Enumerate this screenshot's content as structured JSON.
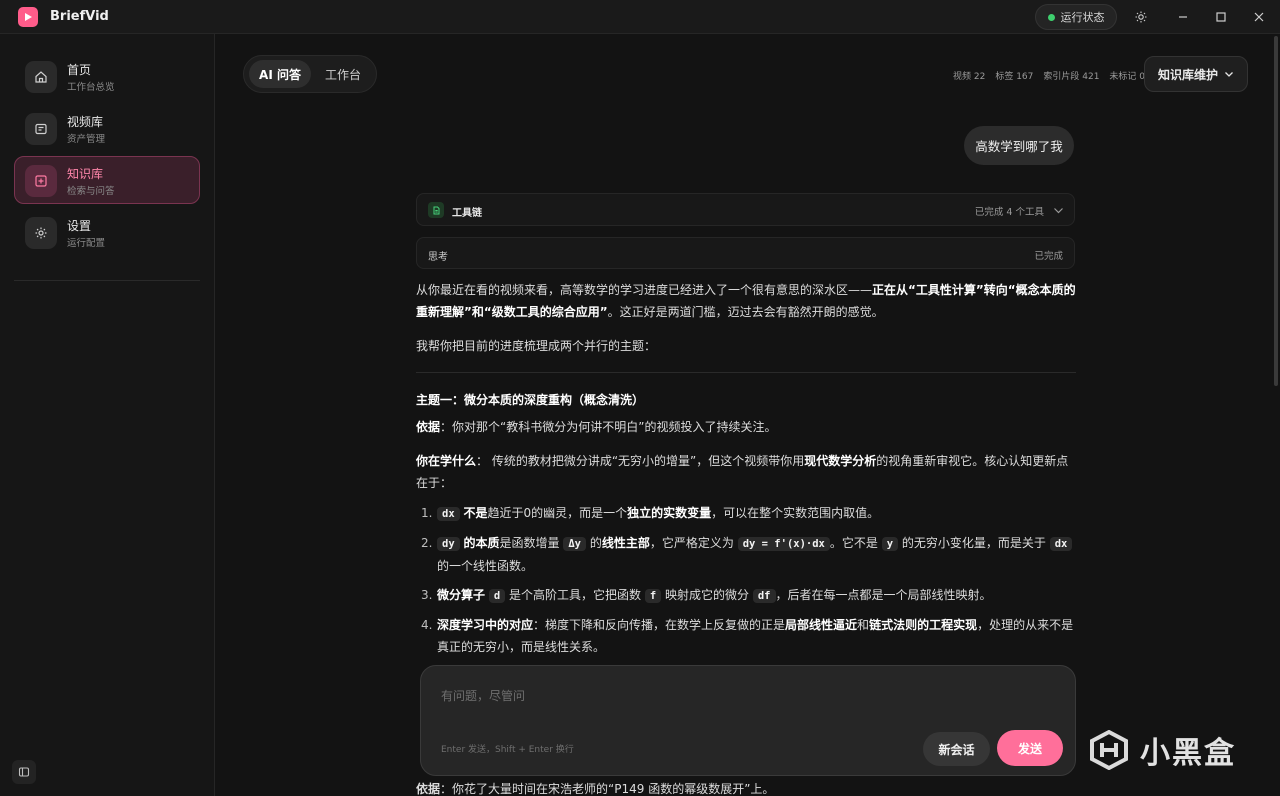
{
  "app": {
    "title": "BriefVid",
    "status_label": "运行状态",
    "status_color": "#3ecf6e",
    "accent": "#ff6f9a"
  },
  "titlebar": {
    "icons": [
      "sun-icon",
      "minimize-icon",
      "maximize-icon",
      "close-icon"
    ]
  },
  "sidebar": {
    "items": [
      {
        "title": "首页",
        "subtitle": "工作台总览",
        "icon": "home-icon"
      },
      {
        "title": "视频库",
        "subtitle": "资产管理",
        "icon": "library-icon"
      },
      {
        "title": "知识库",
        "subtitle": "检索与问答",
        "icon": "knowledge-icon",
        "active": true
      },
      {
        "title": "设置",
        "subtitle": "运行配置",
        "icon": "gear-icon"
      }
    ]
  },
  "tabs": [
    {
      "label": "AI 问答",
      "active": true
    },
    {
      "label": "工作台"
    }
  ],
  "stats": {
    "videos": "视频 22",
    "tags": "标签 167",
    "segments": "索引片段 421",
    "unmarked": "未标记 0"
  },
  "kb_button": {
    "label": "知识库维护"
  },
  "chat": {
    "user_message": "高数学到哪了我",
    "toolchain": {
      "title": "工具链",
      "status": "已完成 4 个工具"
    },
    "thinking": {
      "title": "思考",
      "status": "已完成"
    },
    "intro_1": "从你最近在看的视频来看，高等数学的学习进度已经进入了一个很有意思的深水区——",
    "intro_bold": "正在从“工具性计算”转向“概念本质的重新理解”和“级数工具的综合应用”",
    "intro_2": "。这正好是两道门槛，迈过去会有豁然开朗的感觉。",
    "intro_3": "我帮你把目前的进度梳理成两个并行的主题：",
    "topic1": {
      "heading": "主题一：微分本质的深度重构（概念清洗）",
      "basis_label": "依据",
      "basis_text": "：你对那个“教科书微分为何讲不明白”的视频投入了持续关注。",
      "learn_label": "你在学什么",
      "learn_text_1": "： 传统的教材把微分讲成“无穷小的增量”，但这个视频带你用",
      "learn_bold": "现代数学分析",
      "learn_text_2": "的视角重新审视它。核心认知更新点在于：",
      "items": [
        {
          "c1": "dx",
          "b1": "不是",
          "t1": "趋近于0的幽灵，而是一个",
          "b2": "独立的实数变量",
          "t2": "，可以在整个实数范围内取值。"
        },
        {
          "c1": "dy",
          "b1": "的本质",
          "t1": "是函数增量",
          "c2": "Δy",
          "t2": "的",
          "b2": "线性主部",
          "t3": "，它严格定义为",
          "c3": "dy = f'(x)·dx",
          "t4": "。它不是",
          "c4": "y",
          "t5": "的无穷小变化量，而是关于",
          "c5": "dx",
          "t6": "的一个线性函数。"
        },
        {
          "b1": "微分算子",
          "c1": "d",
          "t1": "是个高阶工具，它把函数",
          "c2": "f",
          "t2": "映射成它的微分",
          "c3": "df",
          "t3": "，后者在每一点都是一个局部线性映射。"
        },
        {
          "b1": "深度学习中的对应",
          "t1": "：梯度下降和反向传播，在数学上反复做的正是",
          "b2": "局部线性逼近",
          "t2": "和",
          "b3": "链式法则的工程实现",
          "t3": "，处理的从来不是真正的无穷小，而是线性关系。"
        }
      ]
    },
    "topic2_basis_label": "依据",
    "topic2_basis_text": "：你花了大量时间在宋浩老师的“P149 函数的幂级数展开”上。"
  },
  "composer": {
    "placeholder": "有问题，尽管问",
    "hint": "Enter 发送，Shift + Enter 换行",
    "new_label": "新会话",
    "send_label": "发送"
  },
  "watermark": {
    "text": "小黑盒"
  }
}
